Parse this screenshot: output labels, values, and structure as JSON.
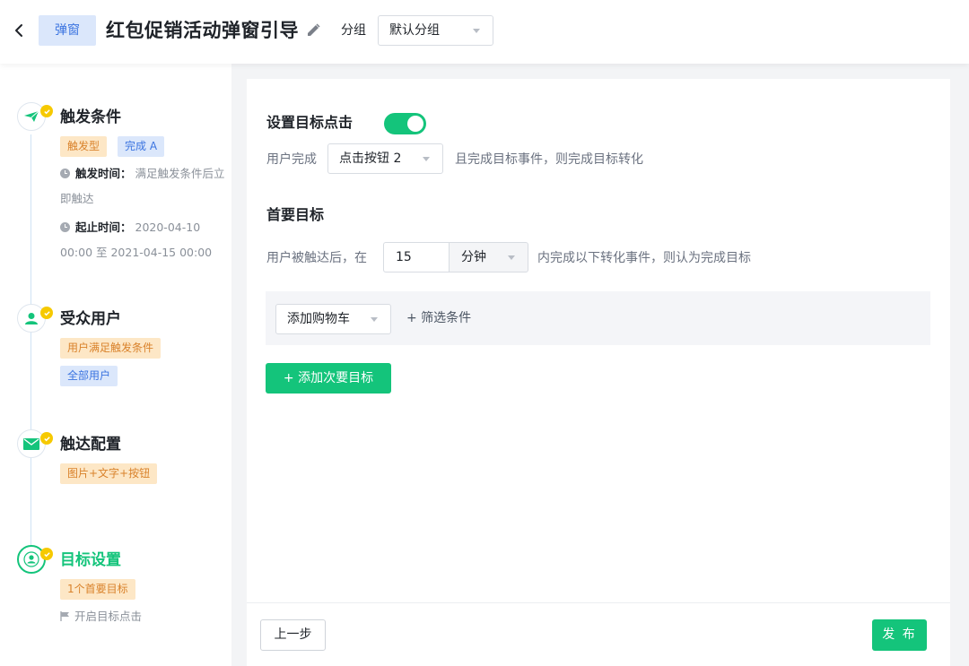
{
  "header": {
    "type_tag": "弹窗",
    "title": "红包促销活动弹窗引导",
    "group_label": "分组",
    "group_value": "默认分组"
  },
  "steps": [
    {
      "title": "触发条件",
      "tags": [
        "触发型",
        "完成 A"
      ],
      "trigger_time_label": "触发时间：",
      "trigger_time_value": "满足触发条件后立即触达",
      "period_label": "起止时间：",
      "period_value": "2020-04-10 00:00 至 2021-04-15 00:00"
    },
    {
      "title": "受众用户",
      "tags": [
        "用户满足触发条件",
        "全部用户"
      ]
    },
    {
      "title": "触达配置",
      "tags": [
        "图片+文字+按钮"
      ]
    },
    {
      "title": "目标设置",
      "tags": [
        "1个首要目标"
      ],
      "note": "开启目标点击"
    }
  ],
  "main": {
    "click_goal": {
      "title": "设置目标点击",
      "enabled": true,
      "prefix": "用户完成",
      "event": "点击按钮 2",
      "suffix": "且完成目标事件，则完成目标转化"
    },
    "primary_goal": {
      "title": "首要目标",
      "prefix": "用户被触达后，在",
      "duration": "15",
      "unit": "分钟",
      "suffix": "内完成以下转化事件，则认为完成目标",
      "event": "添加购物车",
      "filter_label": "+ 筛选条件"
    },
    "add_secondary_label": "+ 添加次要目标"
  },
  "footer": {
    "prev_label": "上一步",
    "publish_label": "发 布"
  },
  "colors": {
    "accent": "#14c47b",
    "blue_tag": "#dbe7fb",
    "orange_tag": "#fde7c6",
    "badge": "#f6c900"
  }
}
